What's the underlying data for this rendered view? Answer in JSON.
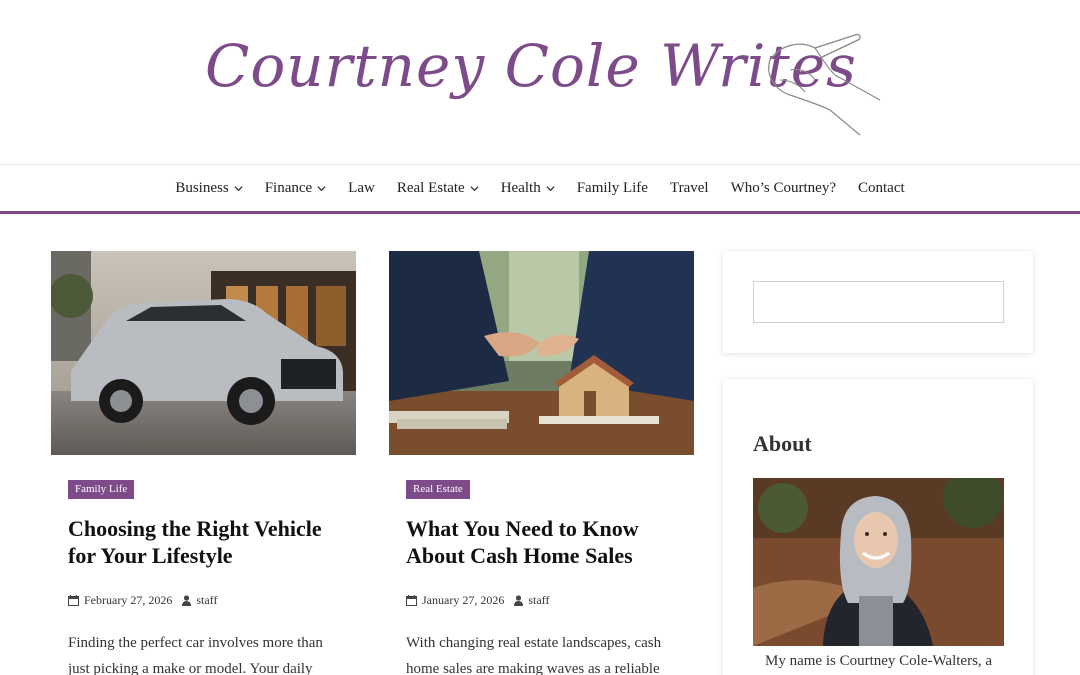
{
  "site": {
    "title": "Courtney Cole Writes"
  },
  "nav": {
    "items": [
      {
        "label": "Business",
        "dropdown": true
      },
      {
        "label": "Finance",
        "dropdown": true
      },
      {
        "label": "Law",
        "dropdown": false
      },
      {
        "label": "Real Estate",
        "dropdown": true
      },
      {
        "label": "Health",
        "dropdown": true
      },
      {
        "label": "Family Life",
        "dropdown": false
      },
      {
        "label": "Travel",
        "dropdown": false
      },
      {
        "label": "Who’s Courtney?",
        "dropdown": false
      },
      {
        "label": "Contact",
        "dropdown": false
      }
    ]
  },
  "posts": [
    {
      "category": "Family Life",
      "title": "Choosing the Right Vehicle for Your Lifestyle",
      "date": "February 27, 2026",
      "author": "staff",
      "excerpt": "Finding the perfect car involves more than just picking a make or model. Your daily"
    },
    {
      "category": "Real Estate",
      "title": "What You Need to Know About Cash Home Sales",
      "date": "January 27, 2026",
      "author": "staff",
      "excerpt": "With changing real estate landscapes, cash home sales are making waves as a reliable"
    }
  ],
  "sidebar": {
    "search": {
      "placeholder": ""
    },
    "about": {
      "title": "About",
      "text": "My name is Courtney Cole-Walters, a"
    }
  },
  "colors": {
    "accent": "#7d4b8a"
  }
}
